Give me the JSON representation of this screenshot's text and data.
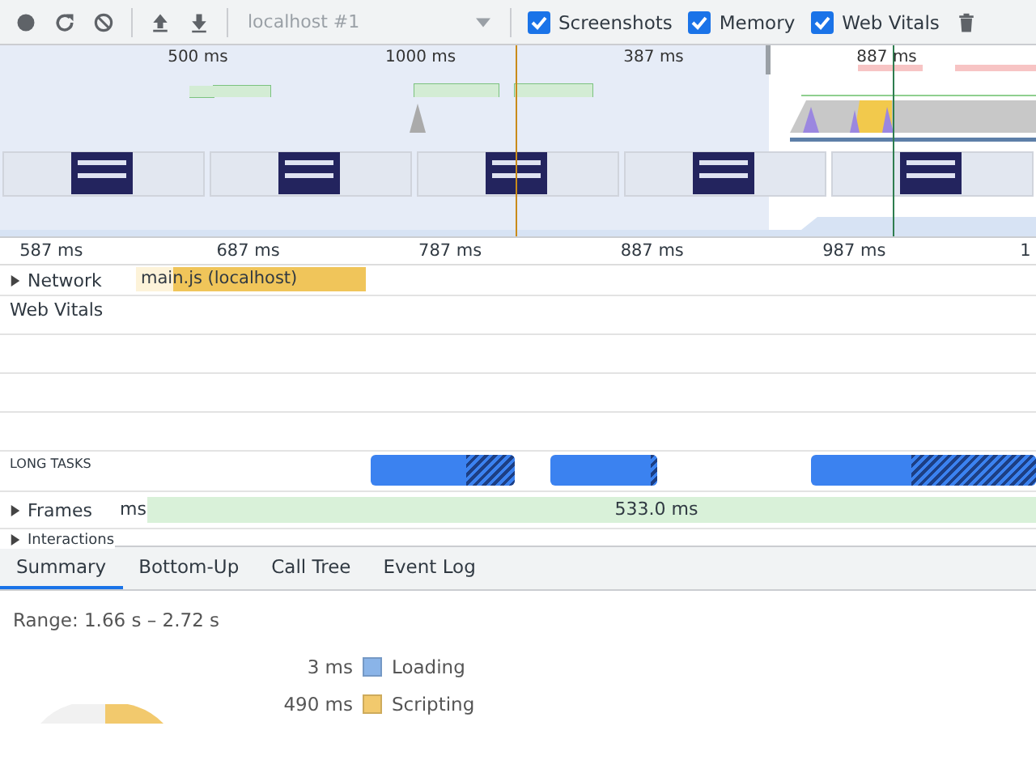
{
  "toolbar": {
    "target": {
      "value": "localhost #1",
      "disabled": true
    },
    "checkboxes": [
      {
        "label": "Screenshots",
        "checked": true
      },
      {
        "label": "Memory",
        "checked": true
      },
      {
        "label": "Web Vitals",
        "checked": true
      }
    ]
  },
  "overview": {
    "ticks": [
      {
        "label": "500 ms"
      },
      {
        "label": "1000 ms"
      },
      {
        "label": "387 ms"
      },
      {
        "label": "887 ms"
      }
    ]
  },
  "ruler": {
    "ticks": [
      {
        "label": "587 ms"
      },
      {
        "label": "687 ms"
      },
      {
        "label": "787 ms"
      },
      {
        "label": "887 ms"
      },
      {
        "label": "987 ms"
      },
      {
        "label": "1"
      }
    ]
  },
  "tracks": [
    {
      "kind": "network",
      "label": "Network",
      "expanded": false,
      "bar_label": "main.js (localhost)"
    },
    {
      "kind": "heading",
      "label": "Web Vitals"
    },
    {
      "kind": "blank"
    },
    {
      "kind": "blank"
    },
    {
      "kind": "blank"
    },
    {
      "kind": "long_tasks",
      "label": "LONG TASKS"
    },
    {
      "kind": "frames",
      "label": "Frames",
      "expanded": false,
      "prefix": "ms",
      "bar_label": "533.0 ms"
    },
    {
      "kind": "interactions",
      "label": "Interactions",
      "expanded": false
    }
  ],
  "tabs": [
    {
      "label": "Summary",
      "selected": true
    },
    {
      "label": "Bottom-Up",
      "selected": false
    },
    {
      "label": "Call Tree",
      "selected": false
    },
    {
      "label": "Event Log",
      "selected": false
    }
  ],
  "summary": {
    "range": "Range: 1.66 s – 2.72 s",
    "legend": [
      {
        "value": "3 ms",
        "label": "Loading",
        "color": "#8ab4e8"
      },
      {
        "value": "490 ms",
        "label": "Scripting",
        "color": "#f2c96d"
      }
    ]
  }
}
